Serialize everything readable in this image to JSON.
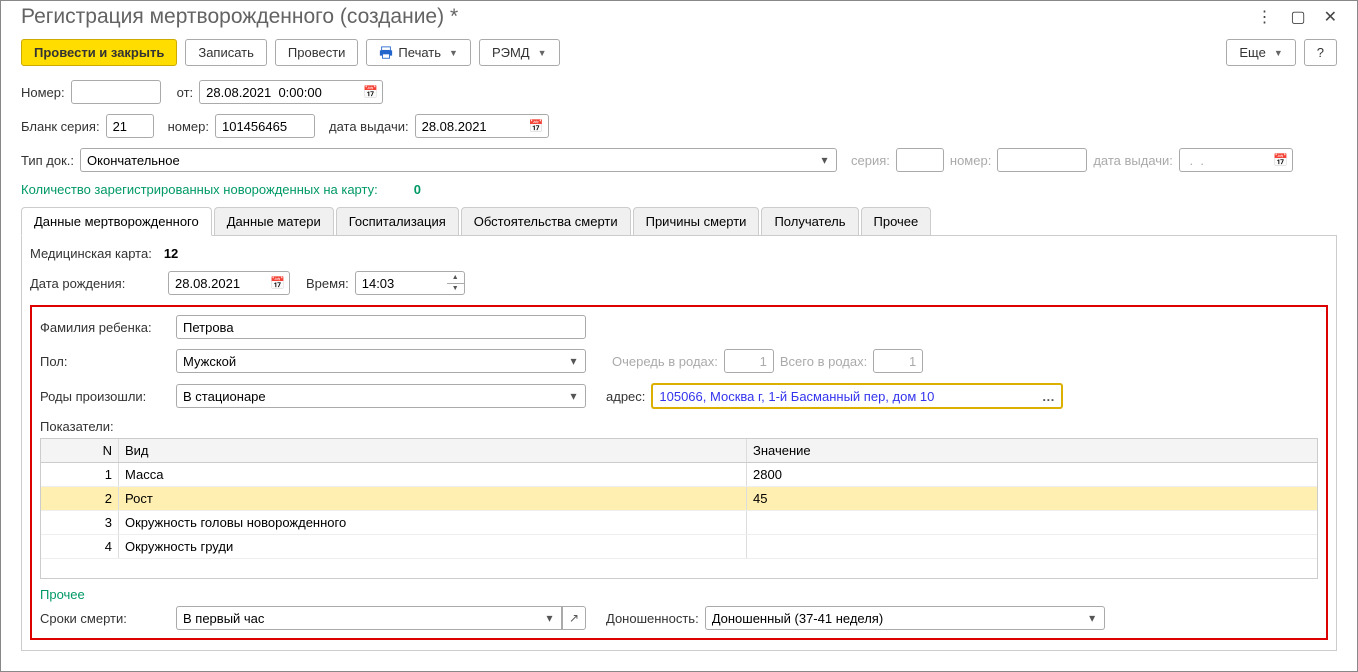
{
  "title": "Регистрация мертворожденного (создание) *",
  "toolbar": {
    "post_close": "Провести и закрыть",
    "record": "Записать",
    "post": "Провести",
    "print": "Печать",
    "remd": "РЭМД",
    "more": "Еще",
    "help": "?"
  },
  "fields": {
    "number_label": "Номер:",
    "number_value": "",
    "from_label": "от:",
    "from_value": "28.08.2021  0:00:00",
    "blank_series_label": "Бланк серия:",
    "blank_series_value": "21",
    "blank_number_label": "номер:",
    "blank_number_value": "101456465",
    "issue_date_label": "дата выдачи:",
    "issue_date_value": "28.08.2021",
    "doctype_label": "Тип док.:",
    "doctype_value": "Окончательное",
    "series2_label": "серия:",
    "series2_value": "",
    "number2_label": "номер:",
    "number2_value": "",
    "issue_date2_label": "дата выдачи:",
    "issue_date2_value": " .  .    ",
    "count_text": "Количество зарегистрированных новорожденных на карту:",
    "count_value": "0"
  },
  "tabs": [
    "Данные мертворожденного",
    "Данные матери",
    "Госпитализация",
    "Обстоятельства смерти",
    "Причины смерти",
    "Получатель",
    "Прочее"
  ],
  "tab_content": {
    "medcard_label": "Медицинская карта:",
    "medcard_value": "12",
    "birthdate_label": "Дата рождения:",
    "birthdate_value": "28.08.2021",
    "time_label": "Время:",
    "time_value": "14:03",
    "surname_label": "Фамилия ребенка:",
    "surname_value": "Петрова",
    "gender_label": "Пол:",
    "gender_value": "Мужской",
    "queue_label": "Очередь в родах:",
    "queue_value": "1",
    "total_label": "Всего в родах:",
    "total_value": "1",
    "birthplace_label": "Роды произошли:",
    "birthplace_value": "В стационаре",
    "address_label": "адрес:",
    "address_value": "105066, Москва г, 1-й Басманный пер, дом 10",
    "indicators_label": "Показатели:",
    "table_header": {
      "n": "N",
      "vid": "Вид",
      "val": "Значение"
    },
    "table_rows": [
      {
        "n": "1",
        "vid": "Масса",
        "val": "2800"
      },
      {
        "n": "2",
        "vid": "Рост",
        "val": "45"
      },
      {
        "n": "3",
        "vid": "Окружность головы новорожденного",
        "val": ""
      },
      {
        "n": "4",
        "vid": "Окружность груди",
        "val": ""
      }
    ],
    "other_label": "Прочее",
    "death_time_label": "Сроки смерти:",
    "death_time_value": "В первый час",
    "term_label": "Доношенность:",
    "term_value": "Доношенный (37-41 неделя)"
  }
}
